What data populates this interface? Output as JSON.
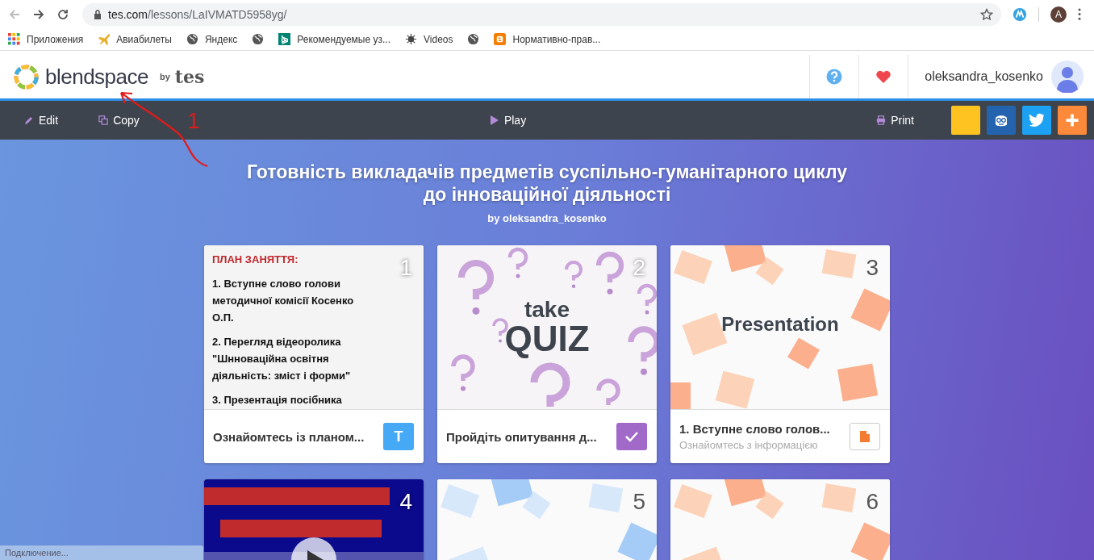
{
  "browser": {
    "url_host": "tes.com",
    "url_path": "/lessons/LaIVMATD5958yg/",
    "profile_initial": "A",
    "bookmarks": [
      {
        "label": "Приложения",
        "kind": "apps"
      },
      {
        "label": "Авиабилеты",
        "kind": "plane"
      },
      {
        "label": "Яндекс",
        "kind": "globe"
      },
      {
        "kind": "globe"
      },
      {
        "label": "Рекомендуемые уз...",
        "kind": "bing"
      },
      {
        "label": "Videos",
        "kind": "sparkle"
      },
      {
        "kind": "globe"
      },
      {
        "label": "Нормативно-прав...",
        "kind": "blogger"
      }
    ]
  },
  "header": {
    "logo": "blendspace",
    "by": "by",
    "partner": "tes",
    "username": "oleksandra_kosenko"
  },
  "toolbar": {
    "left": [
      {
        "label": "Edit",
        "kind": "edit"
      },
      {
        "label": "Copy",
        "kind": "copy"
      }
    ],
    "center": {
      "label": "Play",
      "kind": "play"
    },
    "right": {
      "label": "Print",
      "kind": "print"
    },
    "share": [
      {
        "kind": "blank"
      },
      {
        "kind": "teacher"
      },
      {
        "kind": "twitter"
      },
      {
        "kind": "plus"
      }
    ]
  },
  "annotation": {
    "label": "1"
  },
  "lesson": {
    "title_line1": "Готовність викладачів предметів суспільно-гуманітарного циклу",
    "title_line2": "до інноваційної діяльності",
    "author": "by oleksandra_kosenko"
  },
  "cards": [
    {
      "number": "1",
      "kind": "text",
      "heading": "ПЛАН ЗАНЯТТЯ:",
      "paragraphs": [
        "1. Вступне слово голови методичної комісії Косенко О.П.",
        "2. Перегляд відеоролика \"Шнноваційна освітня діяльність: зміст і форми\"",
        "3. Презентація посібника"
      ],
      "title": "Ознайомтесь із планом...",
      "badge": {
        "kind": "text",
        "label": "T"
      }
    },
    {
      "number": "2",
      "kind": "quiz",
      "line1": "take",
      "line2": "QUIZ",
      "title": "Пройдіть опитування д...",
      "badge": {
        "kind": "quiz"
      }
    },
    {
      "number": "3",
      "kind": "presentation",
      "label": "Presentation",
      "title": "1. Вступне слово голов...",
      "subtitle": "Ознайомтесь з інформацією",
      "badge": {
        "kind": "file"
      }
    },
    {
      "number": "4",
      "kind": "video"
    },
    {
      "number": "5",
      "kind": "document"
    },
    {
      "number": "6",
      "kind": "presentation"
    }
  ],
  "status_bar": "Подключение..."
}
